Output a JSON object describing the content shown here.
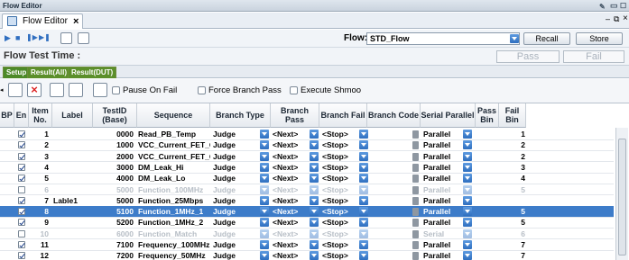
{
  "window": {
    "title": "Flow Editor"
  },
  "tab": {
    "label": "Flow Editor"
  },
  "toolbar": {
    "flow_label": "Flow:",
    "flow_value": "STD_Flow",
    "recall_label": "Recall",
    "store_label": "Store"
  },
  "flow_test_time": {
    "label": "Flow Test Time :",
    "pass_label": "Pass",
    "fail_label": "Fail"
  },
  "subtabs": [
    "Setup",
    "Result(All)",
    "Result(DUT)"
  ],
  "options": {
    "pause_on_fail": "Pause On Fail",
    "force_branch_pass": "Force Branch Pass",
    "execute_shmoo": "Execute Shmoo"
  },
  "columns": [
    "BP",
    "En",
    "Item No.",
    "Label",
    "TestID (Base)",
    "Sequence",
    "Branch Type",
    "Branch Pass",
    "Branch Fail",
    "Branch Code",
    "Serial Parallel",
    "Pass Bin",
    "Fail Bin"
  ],
  "rows": [
    {
      "en": true,
      "item": "1",
      "label": "",
      "testid": "0000",
      "seq": "Read_PB_Temp",
      "type": "Judge",
      "pass": "<Next>",
      "fail": "<Stop>",
      "sp": "Parallel",
      "pbin": "",
      "fbin": "1",
      "state": "normal"
    },
    {
      "en": true,
      "item": "2",
      "label": "",
      "testid": "1000",
      "seq": "VCC_Current_FET_ON",
      "type": "Judge",
      "pass": "<Next>",
      "fail": "<Stop>",
      "sp": "Parallel",
      "pbin": "",
      "fbin": "2",
      "state": "normal"
    },
    {
      "en": true,
      "item": "3",
      "label": "",
      "testid": "2000",
      "seq": "VCC_Current_FET_OFF",
      "type": "Judge",
      "pass": "<Next>",
      "fail": "<Stop>",
      "sp": "Parallel",
      "pbin": "",
      "fbin": "2",
      "state": "normal"
    },
    {
      "en": true,
      "item": "4",
      "label": "",
      "testid": "3000",
      "seq": "DM_Leak_Hi",
      "type": "Judge",
      "pass": "<Next>",
      "fail": "<Stop>",
      "sp": "Parallel",
      "pbin": "",
      "fbin": "3",
      "state": "normal"
    },
    {
      "en": true,
      "item": "5",
      "label": "",
      "testid": "4000",
      "seq": "DM_Leak_Lo",
      "type": "Judge",
      "pass": "<Next>",
      "fail": "<Stop>",
      "sp": "Parallel",
      "pbin": "",
      "fbin": "4",
      "state": "normal"
    },
    {
      "en": false,
      "item": "6",
      "label": "",
      "testid": "5000",
      "seq": "Function_100MHz",
      "type": "Judge",
      "pass": "<Next>",
      "fail": "<Stop>",
      "sp": "Parallel",
      "pbin": "",
      "fbin": "5",
      "state": "disabled"
    },
    {
      "en": true,
      "item": "7",
      "label": "Lable1",
      "testid": "5000",
      "seq": "Function_25Mbps",
      "type": "Judge",
      "pass": "<Next>",
      "fail": "<Stop>",
      "sp": "Parallel",
      "pbin": "",
      "fbin": "",
      "state": "normal"
    },
    {
      "en": true,
      "item": "8",
      "label": "",
      "testid": "5100",
      "seq": "Function_1MHz_1",
      "type": "Judge",
      "pass": "<Next>",
      "fail": "<Stop>",
      "sp": "Parallel",
      "pbin": "",
      "fbin": "5",
      "state": "selected"
    },
    {
      "en": true,
      "item": "9",
      "label": "",
      "testid": "5200",
      "seq": "Function_1MHz_2",
      "type": "Judge",
      "pass": "<Next>",
      "fail": "<Stop>",
      "sp": "Parallel",
      "pbin": "",
      "fbin": "5",
      "state": "normal"
    },
    {
      "en": false,
      "item": "10",
      "label": "",
      "testid": "6000",
      "seq": "Function_Match",
      "type": "Judge",
      "pass": "<Next>",
      "fail": "<Stop>",
      "sp": "Serial",
      "pbin": "",
      "fbin": "6",
      "state": "disabled"
    },
    {
      "en": true,
      "item": "11",
      "label": "",
      "testid": "7100",
      "seq": "Frequency_100MHz",
      "type": "Judge",
      "pass": "<Next>",
      "fail": "<Stop>",
      "sp": "Parallel",
      "pbin": "",
      "fbin": "7",
      "state": "normal"
    },
    {
      "en": true,
      "item": "12",
      "label": "",
      "testid": "7200",
      "seq": "Frequency_50MHz",
      "type": "Judge",
      "pass": "<Next>",
      "fail": "<Stop>",
      "sp": "Parallel",
      "pbin": "",
      "fbin": "7",
      "state": "normal"
    }
  ]
}
